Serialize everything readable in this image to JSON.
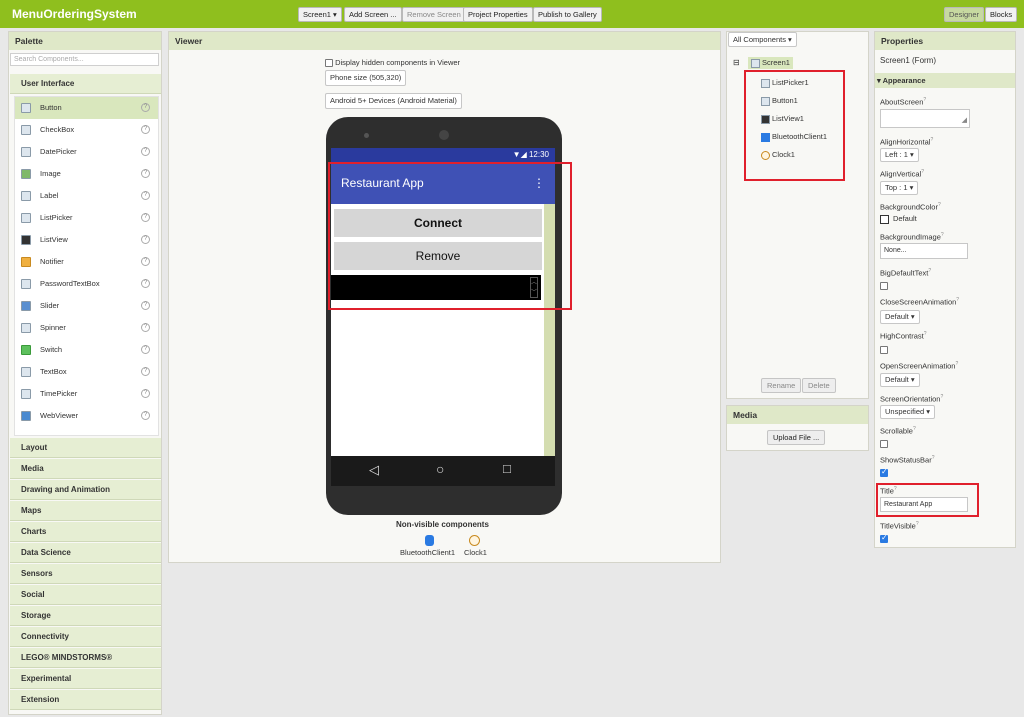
{
  "app": {
    "title": "MenuOrderingSystem"
  },
  "toolbar": {
    "screen_select": "Screen1 ▾",
    "add_screen": "Add Screen ...",
    "remove_screen": "Remove Screen",
    "project_properties": "Project Properties",
    "publish": "Publish to Gallery",
    "designer": "Designer",
    "blocks": "Blocks"
  },
  "palette": {
    "title": "Palette",
    "search_placeholder": "Search Components...",
    "open_category": "User Interface",
    "items": [
      {
        "label": "Button",
        "icon": "button-icon"
      },
      {
        "label": "CheckBox",
        "icon": "checkbox-icon"
      },
      {
        "label": "DatePicker",
        "icon": "datepicker-icon"
      },
      {
        "label": "Image",
        "icon": "image-icon"
      },
      {
        "label": "Label",
        "icon": "label-icon"
      },
      {
        "label": "ListPicker",
        "icon": "listpicker-icon"
      },
      {
        "label": "ListView",
        "icon": "listview-icon"
      },
      {
        "label": "Notifier",
        "icon": "notifier-icon"
      },
      {
        "label": "PasswordTextBox",
        "icon": "password-icon"
      },
      {
        "label": "Slider",
        "icon": "slider-icon"
      },
      {
        "label": "Spinner",
        "icon": "spinner-icon"
      },
      {
        "label": "Switch",
        "icon": "switch-icon"
      },
      {
        "label": "TextBox",
        "icon": "textbox-icon"
      },
      {
        "label": "TimePicker",
        "icon": "timepicker-icon"
      },
      {
        "label": "WebViewer",
        "icon": "webviewer-icon"
      }
    ],
    "help_glyph": "?",
    "categories": [
      "Layout",
      "Media",
      "Drawing and Animation",
      "Maps",
      "Charts",
      "Data Science",
      "Sensors",
      "Social",
      "Storage",
      "Connectivity",
      "LEGO® MINDSTORMS®",
      "Experimental",
      "Extension"
    ]
  },
  "viewer": {
    "title": "Viewer",
    "hidden_checkbox_label": "Display hidden components in Viewer",
    "phone_size": "Phone size (505,320)",
    "theme": "Android 5+ Devices (Android Material)",
    "status_time": "12:30",
    "app_title": "Restaurant App",
    "menu_glyph": "⋮",
    "buttons": [
      "Connect",
      "Remove"
    ],
    "nonvisible_title": "Non-visible components",
    "nonvisible": [
      "BluetoothClient1",
      "Clock1"
    ],
    "nav": {
      "back": "◁",
      "home": "○",
      "recent": "□"
    }
  },
  "components": {
    "filter": "All Components ▾",
    "collapse_glyph": "⊟",
    "root": "Screen1",
    "children": [
      "ListPicker1",
      "Button1",
      "ListView1",
      "BluetoothClient1",
      "Clock1"
    ],
    "rename": "Rename",
    "delete": "Delete"
  },
  "media": {
    "title": "Media",
    "upload": "Upload File ..."
  },
  "properties": {
    "title": "Properties",
    "subtitle": "Screen1 (Form)",
    "section": "▾ Appearance",
    "help_glyph": "?",
    "about_screen": "AboutScreen",
    "align_horizontal": "AlignHorizontal",
    "align_horizontal_value": "Left : 1 ▾",
    "align_vertical": "AlignVertical",
    "align_vertical_value": "Top : 1 ▾",
    "background_color": "BackgroundColor",
    "background_color_value": "Default",
    "background_image": "BackgroundImage",
    "background_image_value": "None...",
    "big_default_text": "BigDefaultText",
    "close_anim": "CloseScreenAnimation",
    "close_anim_value": "Default ▾",
    "high_contrast": "HighContrast",
    "open_anim": "OpenScreenAnimation",
    "open_anim_value": "Default ▾",
    "orientation": "ScreenOrientation",
    "orientation_value": "Unspecified ▾",
    "scrollable": "Scrollable",
    "show_status_bar": "ShowStatusBar",
    "title_label": "Title",
    "title_value": "Restaurant App",
    "title_visible": "TitleVisible"
  },
  "colors": {
    "accent": "#8fbf1e",
    "appbar": "#3f51b5",
    "highlight": "#e0202c"
  }
}
